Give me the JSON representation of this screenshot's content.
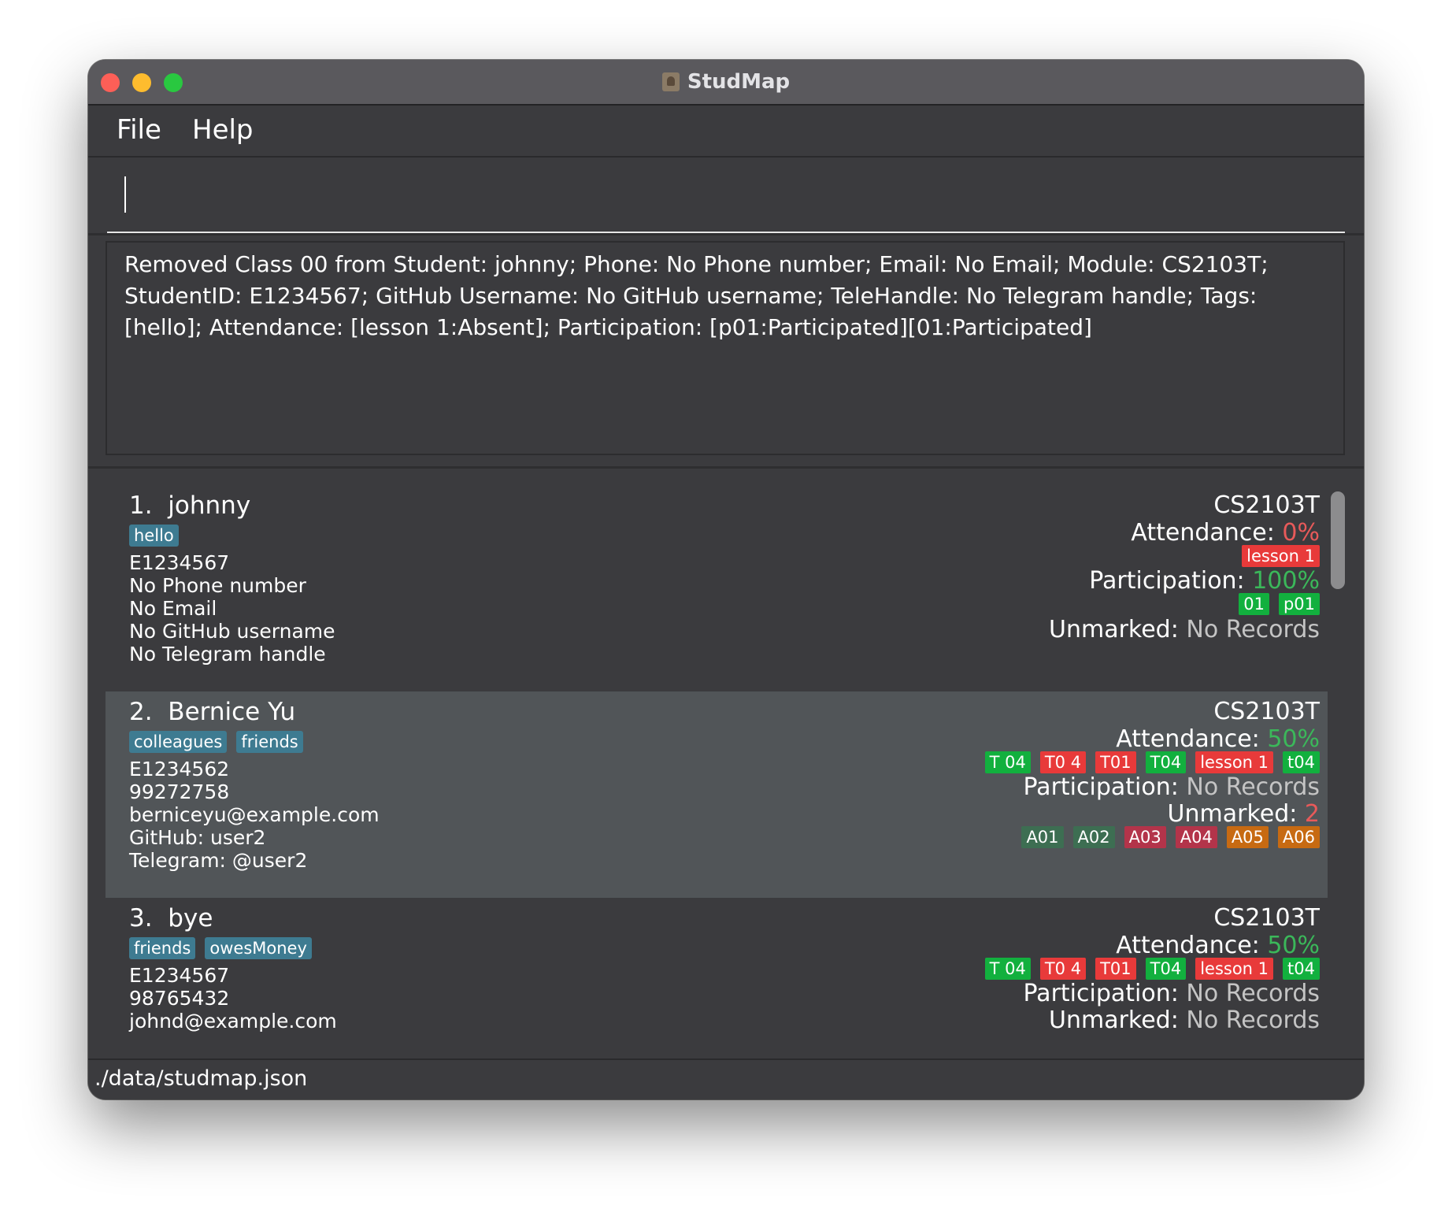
{
  "window": {
    "title": "StudMap"
  },
  "menu": {
    "file": "File",
    "help": "Help"
  },
  "command": {
    "value": ""
  },
  "result": {
    "text": "Removed Class 00 from Student: johnny; Phone: No Phone number; Email: No Email; Module: CS2103T; StudentID: E1234567; GitHub Username: No GitHub username; TeleHandle: No Telegram handle; Tags: [hello]; Attendance: [lesson 1:Absent]; Participation: [p01:Participated][01:Participated]"
  },
  "students": [
    {
      "index": "1.",
      "name": "johnny",
      "tags": [
        "hello"
      ],
      "id": "E1234567",
      "phone": "No Phone number",
      "email": "No Email",
      "github": "No GitHub username",
      "telegram": "No Telegram handle",
      "module": "CS2103T",
      "attendance_label": "Attendance: ",
      "attendance_value": "0%",
      "attendance_chips": [
        {
          "label": "lesson 1",
          "status": "red"
        }
      ],
      "participation_label": "Participation: ",
      "participation_value": "100%",
      "participation_chips": [
        {
          "label": "01",
          "status": "green"
        },
        {
          "label": "p01",
          "status": "green"
        }
      ],
      "unmarked_label": "Unmarked: ",
      "unmarked_value": "No Records",
      "unmarked_chips": []
    },
    {
      "index": "2.",
      "name": "Bernice Yu",
      "tags": [
        "colleagues",
        "friends"
      ],
      "id": "E1234562",
      "phone": "99272758",
      "email": "berniceyu@example.com",
      "github": "GitHub: user2",
      "telegram": "Telegram: @user2",
      "module": "CS2103T",
      "attendance_label": "Attendance: ",
      "attendance_value": "50%",
      "attendance_chips": [
        {
          "label": "T 04",
          "status": "green"
        },
        {
          "label": "T0 4",
          "status": "red"
        },
        {
          "label": "T01",
          "status": "red"
        },
        {
          "label": "T04",
          "status": "green"
        },
        {
          "label": "lesson 1",
          "status": "red"
        },
        {
          "label": "t04",
          "status": "green"
        }
      ],
      "participation_label": "Participation: ",
      "participation_value": "No Records",
      "participation_chips": [],
      "unmarked_label": "Unmarked: ",
      "unmarked_value": "2",
      "unmarked_chips": [
        {
          "label": "A01",
          "status": "dkgreen"
        },
        {
          "label": "A02",
          "status": "dkgreen"
        },
        {
          "label": "A03",
          "status": "crimson"
        },
        {
          "label": "A04",
          "status": "crimson"
        },
        {
          "label": "A05",
          "status": "orange"
        },
        {
          "label": "A06",
          "status": "orange"
        }
      ]
    },
    {
      "index": "3.",
      "name": "bye",
      "tags": [
        "friends",
        "owesMoney"
      ],
      "id": "E1234567",
      "phone": "98765432",
      "email": "johnd@example.com",
      "github": "",
      "telegram": "",
      "module": "CS2103T",
      "attendance_label": "Attendance: ",
      "attendance_value": "50%",
      "attendance_chips": [
        {
          "label": "T 04",
          "status": "green"
        },
        {
          "label": "T0 4",
          "status": "red"
        },
        {
          "label": "T01",
          "status": "red"
        },
        {
          "label": "T04",
          "status": "green"
        },
        {
          "label": "lesson 1",
          "status": "red"
        },
        {
          "label": "t04",
          "status": "green"
        }
      ],
      "participation_label": "Participation: ",
      "participation_value": "No Records",
      "participation_chips": [],
      "unmarked_label": "Unmarked: ",
      "unmarked_value": "No Records",
      "unmarked_chips": []
    }
  ],
  "status": {
    "path": "./data/studmap.json"
  },
  "colors": {
    "tag": "#3e7b91",
    "present": "#12b03e",
    "absent": "#e83a3a",
    "percent_low": "#e85a5a",
    "percent_high": "#3bb85a"
  }
}
